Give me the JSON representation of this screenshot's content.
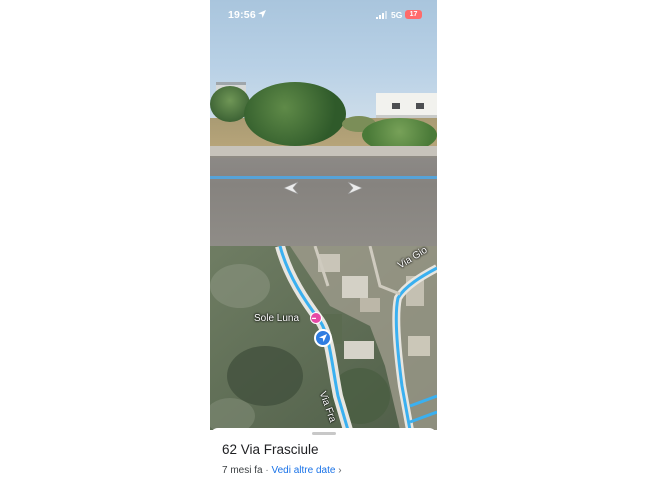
{
  "status_bar": {
    "time": "19:56",
    "network": "5G",
    "battery": "17",
    "icons": [
      "location-arrow-icon",
      "signal-icon",
      "battery-icon"
    ]
  },
  "street_view": {
    "nav_arrows": [
      "arrow-left-icon",
      "arrow-right-icon"
    ]
  },
  "map": {
    "poi_name": "Sole Luna",
    "poi_icon": "hotel-pin-icon",
    "street_1": "Via Gio",
    "street_2": "Via Fra",
    "route_color": "#3ab0f0",
    "location_color": "#2f7de1"
  },
  "sheet": {
    "address": "62 Via Frasciule",
    "date_label": "7 mesi fa",
    "separator": "·",
    "more_dates": "Vedi altre date",
    "chevron": "›"
  }
}
